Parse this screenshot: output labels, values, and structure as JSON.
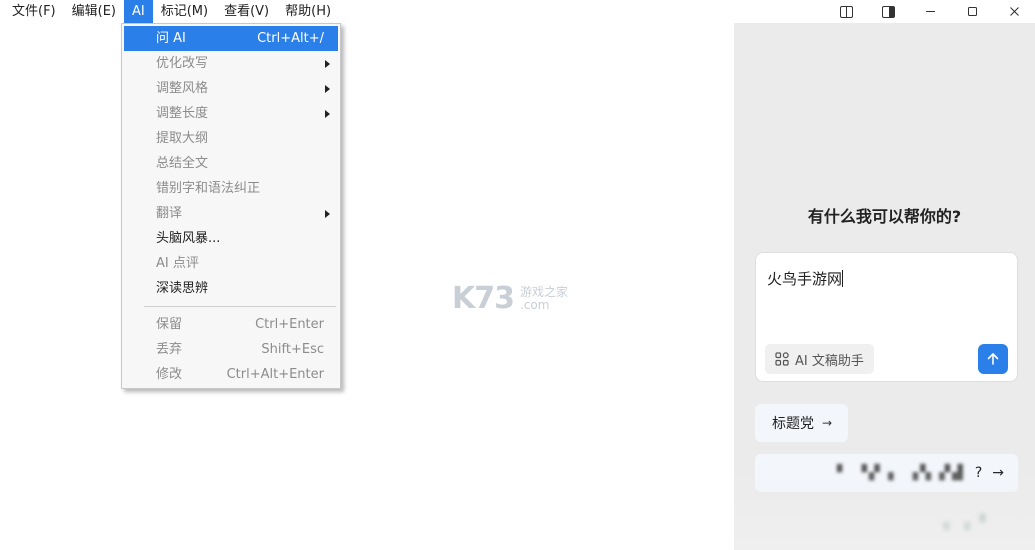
{
  "menubar": {
    "items": [
      {
        "label": "文件(F)"
      },
      {
        "label": "编辑(E)"
      },
      {
        "label": "AI"
      },
      {
        "label": "标记(M)"
      },
      {
        "label": "查看(V)"
      },
      {
        "label": "帮助(H)"
      }
    ]
  },
  "window_controls": [
    "sidebar-left-icon",
    "sidebar-right-icon",
    "minimize-icon",
    "maximize-icon",
    "close-icon"
  ],
  "ai_menu": {
    "items": [
      {
        "label": "问 AI",
        "shortcut": "Ctrl+Alt+/"
      },
      {
        "label": "优化改写"
      },
      {
        "label": "调整风格"
      },
      {
        "label": "调整长度"
      },
      {
        "label": "提取大纲"
      },
      {
        "label": "总结全文"
      },
      {
        "label": "错别字和语法纠正"
      },
      {
        "label": "翻译"
      },
      {
        "label": "头脑风暴..."
      },
      {
        "label": "AI 点评"
      },
      {
        "label": "深读思辨"
      },
      {
        "label": "保留",
        "shortcut": "Ctrl+Enter"
      },
      {
        "label": "丢弃",
        "shortcut": "Shift+Esc"
      },
      {
        "label": "修改",
        "shortcut": "Ctrl+Alt+Enter"
      }
    ]
  },
  "watermark": {
    "main": "K73",
    "cn": "游戏之家",
    "com": ".com"
  },
  "ai_panel": {
    "heading": "有什么我可以帮你的?",
    "input_value": "火鸟手游网",
    "assistant_label": "AI 文稿助手",
    "chip_label": "标题党",
    "suggestion_tail": "?"
  },
  "colors": {
    "accent": "#2b7fe8",
    "panel_bg": "#ebebeb",
    "menu_bg": "#f7f7f7"
  }
}
